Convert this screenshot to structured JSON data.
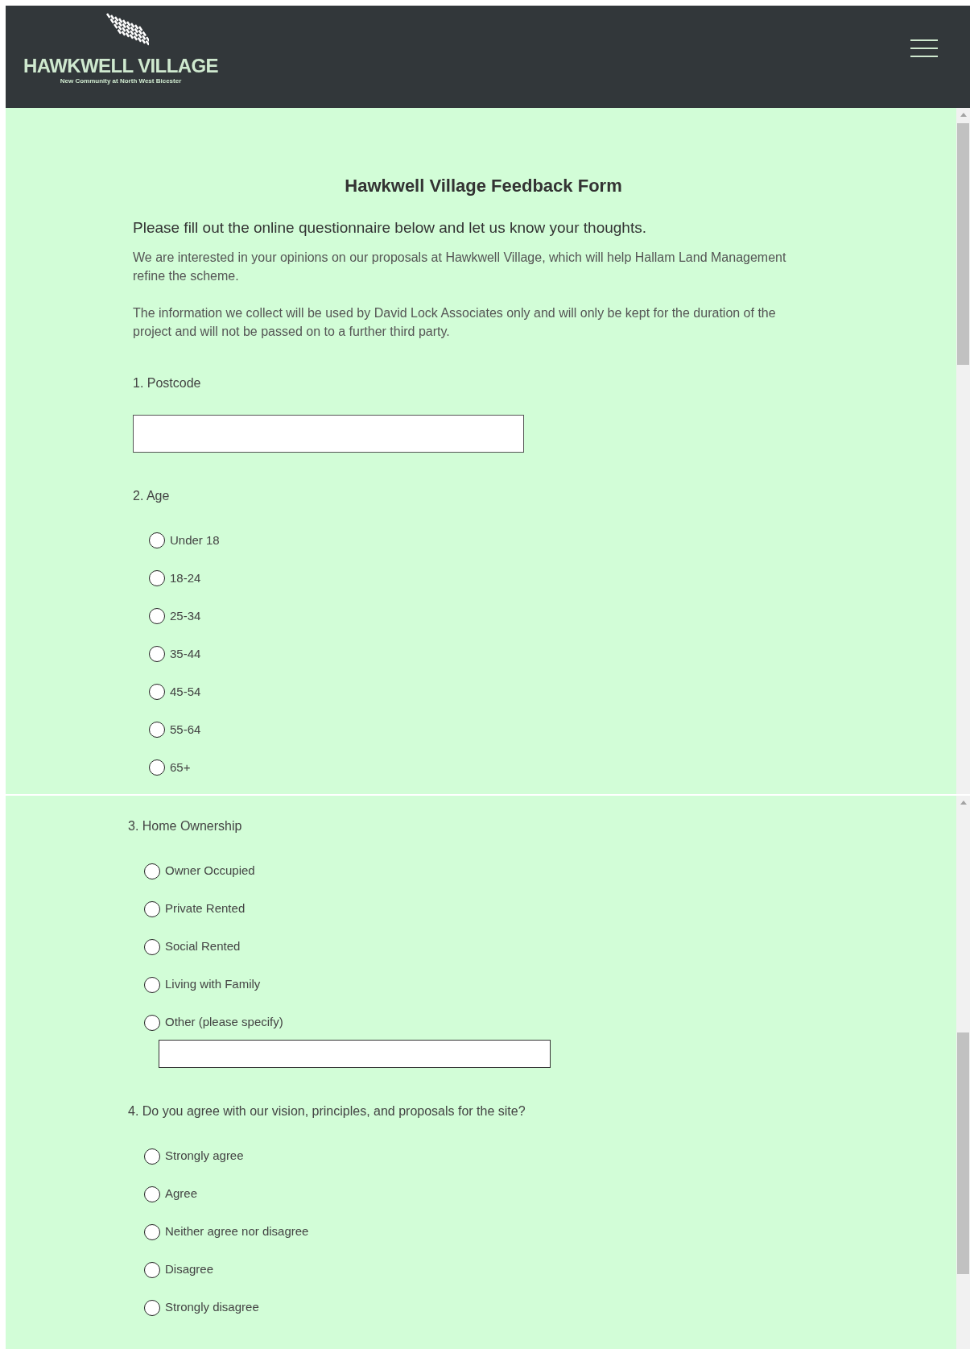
{
  "header": {
    "logo_title": "HAWKWELL VILLAGE",
    "logo_tagline": "New Community at North West Bicester"
  },
  "panels": [
    {
      "title": "Hawkwell Village Feedback Form",
      "subtitle": "Please fill out the online questionnaire below and let us know your thoughts.",
      "paragraphs": [
        "We are interested in your opinions on our proposals at Hawkwell Village, which will help Hallam Land Management refine the scheme.",
        "The information we collect will be used by David Lock Associates only and will only be kept for the duration of the project and will not be passed on to a further third party."
      ],
      "questions": [
        {
          "kind": "text",
          "label": "1. Postcode"
        },
        {
          "kind": "radio",
          "label": "2. Age",
          "options": [
            {
              "label": "Under 18",
              "selected": false
            },
            {
              "label": "18-24",
              "selected": false
            },
            {
              "label": "25-34",
              "selected": false
            },
            {
              "label": "35-44",
              "selected": false
            },
            {
              "label": "45-54",
              "selected": false
            },
            {
              "label": "55-64",
              "selected": false
            },
            {
              "label": "65+",
              "selected": false
            }
          ]
        }
      ]
    },
    {
      "questions": [
        {
          "kind": "radio",
          "label": "3. Home Ownership",
          "options": [
            {
              "label": "Owner Occupied",
              "selected": false
            },
            {
              "label": "Private Rented",
              "selected": false
            },
            {
              "label": "Social Rented",
              "selected": false
            },
            {
              "label": "Living with Family",
              "selected": false
            },
            {
              "label": "Other (please specify)",
              "selected": false,
              "kind": "with_field"
            }
          ]
        },
        {
          "kind": "radio",
          "label": "4. Do you agree with our vision, principles, and proposals for the site?",
          "options": [
            {
              "label": "Strongly agree",
              "selected": false
            },
            {
              "label": "Agree",
              "selected": false
            },
            {
              "label": "Neither agree nor disagree",
              "selected": false
            },
            {
              "label": "Disagree",
              "selected": false
            },
            {
              "label": "Strongly disagree",
              "selected": false
            }
          ]
        }
      ]
    }
  ]
}
